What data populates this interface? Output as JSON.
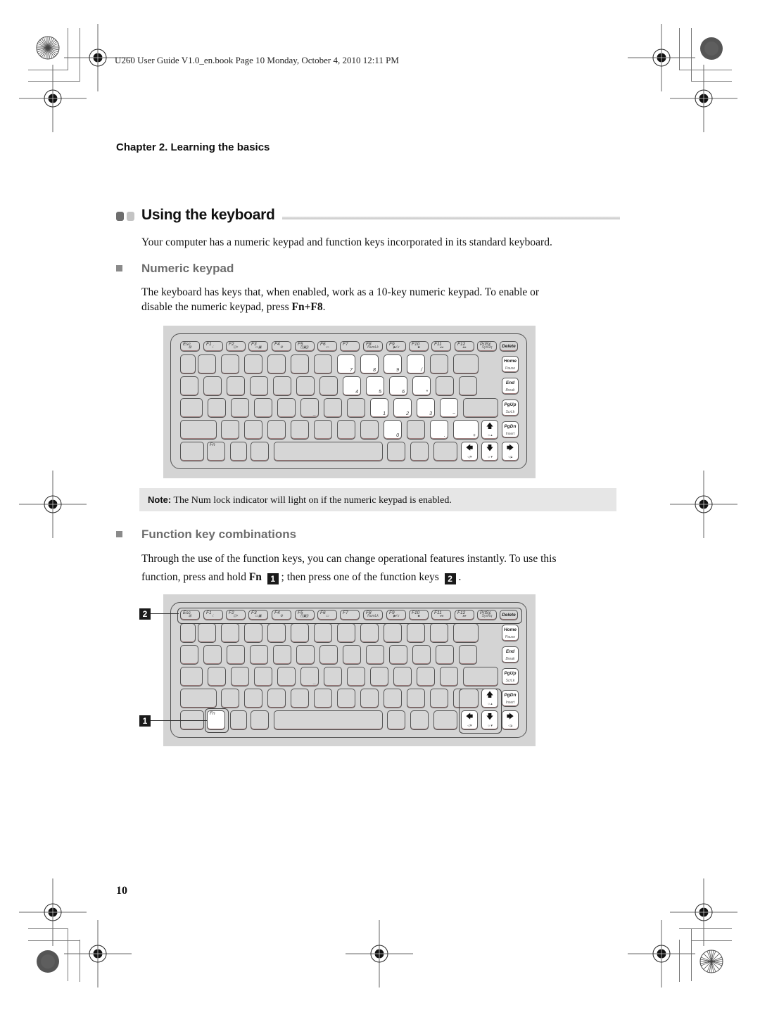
{
  "header": {
    "print_info": "U260 User Guide V1.0_en.book  Page 10  Monday, October 4, 2010  12:11 PM"
  },
  "chapter": "Chapter 2. Learning the basics",
  "section": {
    "title": "Using the keyboard",
    "intro": "Your computer has a numeric keypad and function keys incorporated in its standard keyboard.",
    "accent_dark": "#6e6e6e",
    "accent_light": "#c4c4c4"
  },
  "numeric_keypad": {
    "heading": "Numeric keypad",
    "body_line1": "The keyboard has keys that, when enabled, work as a 10-key numeric keypad. To enable or",
    "body_line2_pre": "disable the numeric keypad, press ",
    "body_line2_bold": "Fn+F8",
    "body_line2_post": "."
  },
  "note": {
    "label": "Note:",
    "text": " The Num lock indicator will light on if the numeric keypad is enabled."
  },
  "function_keys": {
    "heading": "Function key combinations",
    "body_line1": "Through the use of the function keys, you can change operational features instantly. To use this",
    "body_line2_pre": "function, press and hold ",
    "body_line2_bold": "Fn",
    "callout1": "1",
    "body_line2_mid": "; then press one of the function keys",
    "callout2": "2",
    "body_line2_post": "."
  },
  "keyboard": {
    "fkeys": [
      {
        "label": "Esc",
        "sub": "⊠"
      },
      {
        "label": "F1",
        "sub": "☾"
      },
      {
        "label": "F2",
        "sub": "⊡×"
      },
      {
        "label": "F3",
        "sub": "▭▣"
      },
      {
        "label": "F4",
        "sub": "⚙"
      },
      {
        "label": "F5",
        "sub": "((▣))"
      },
      {
        "label": "F6",
        "sub": "▭"
      },
      {
        "label": "F7",
        "sub": ""
      },
      {
        "label": "F8",
        "sub": "NumLk"
      },
      {
        "label": "F9",
        "sub": "▶/॥"
      },
      {
        "label": "F10",
        "sub": "■"
      },
      {
        "label": "F11",
        "sub": "◂◂"
      },
      {
        "label": "F12",
        "sub": "▸▸"
      },
      {
        "label": "PrtSc",
        "sub": "SysRq"
      },
      {
        "label": "Delete",
        "sub": ""
      }
    ],
    "side_keys": [
      {
        "label": "Home",
        "sub": "Pause"
      },
      {
        "label": "End",
        "sub": "Break"
      },
      {
        "label": "PgUp",
        "sub": "ScrLk"
      },
      {
        "label": "PgDn",
        "sub": "Insert"
      }
    ],
    "numpad_row1": [
      "7",
      "8",
      "9",
      "/"
    ],
    "numpad_row2": [
      "4",
      "5",
      "6",
      "*"
    ],
    "numpad_row3": [
      "1",
      "2",
      "3",
      "−"
    ],
    "numpad_row4": [
      "0",
      ".",
      "+"
    ],
    "fn_label": "Fn",
    "arrows": {
      "up": "🡅",
      "down": "🡇",
      "left": "🡄",
      "right": "🡆"
    },
    "arrow_subs": {
      "up": "☼▴",
      "down": "☼▾",
      "left": "◁▾",
      "right": "◁▴"
    }
  },
  "callouts": {
    "one": "1",
    "two": "2"
  },
  "page_number": "10"
}
